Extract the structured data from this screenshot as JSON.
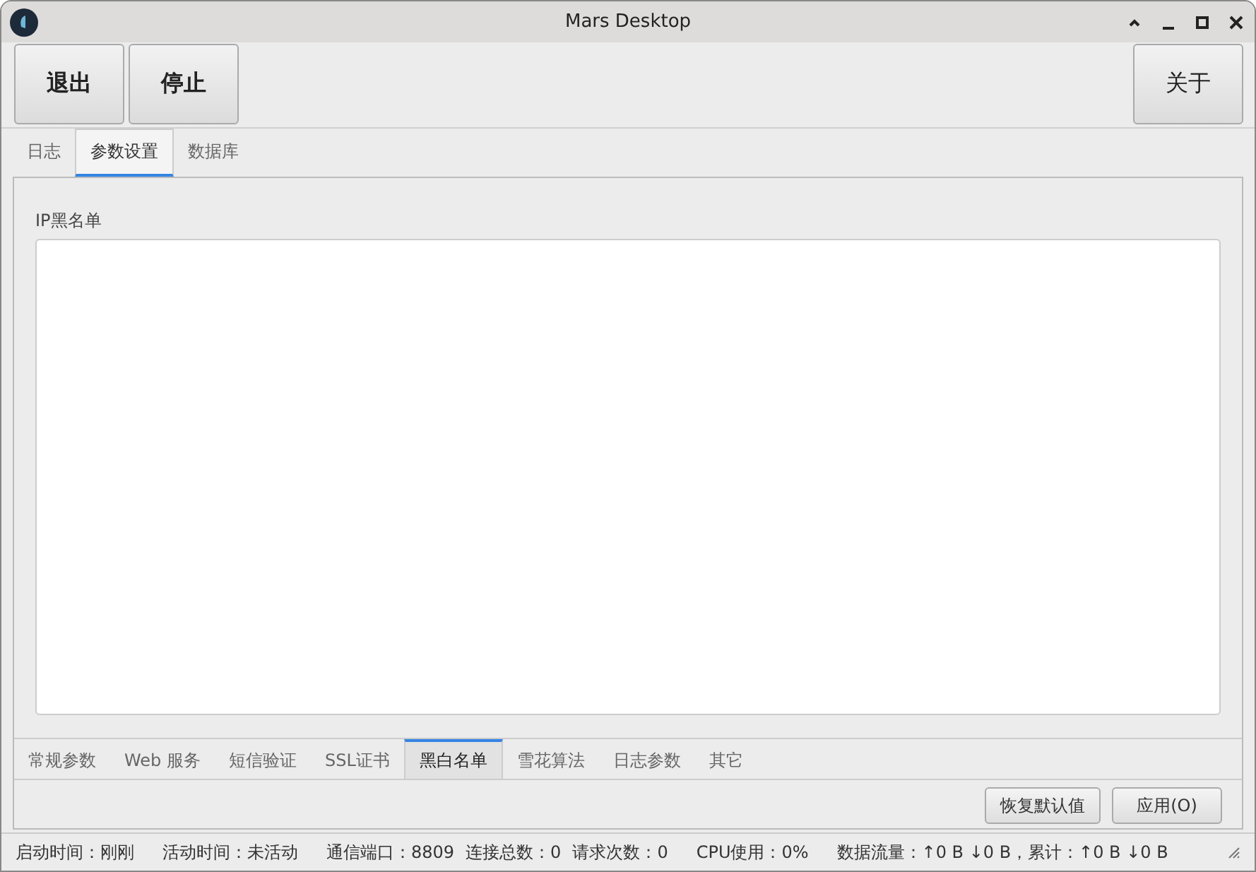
{
  "window": {
    "title": "Mars Desktop"
  },
  "toolbar": {
    "left_buttons": [
      "退出",
      "停止"
    ],
    "right_button": "关于"
  },
  "tabs": [
    {
      "label": "日志",
      "selected": false
    },
    {
      "label": "参数设置",
      "selected": true
    },
    {
      "label": "数据库",
      "selected": false
    }
  ],
  "blacklist": {
    "label": "IP黑名单"
  },
  "sub_tabs": [
    {
      "label": "常规参数",
      "selected": false
    },
    {
      "label": "Web 服务",
      "selected": false
    },
    {
      "label": "短信验证",
      "selected": false
    },
    {
      "label": "SSL证书",
      "selected": false
    },
    {
      "label": "黑白名单",
      "selected": true
    },
    {
      "label": "雪花算法",
      "selected": false
    },
    {
      "label": "日志参数",
      "selected": false
    },
    {
      "label": "其它",
      "selected": false
    }
  ],
  "actions": [
    "恢复默认值",
    "应用(O)"
  ],
  "status_bar": [
    "启动时间：刚刚",
    "活动时间：未活动",
    "通信端口：8809",
    "连接总数：0",
    "请求次数：0",
    "CPU使用：0%",
    "数据流量：↑0 B ↓0 B，累计：↑0 B ↓0 B"
  ]
}
